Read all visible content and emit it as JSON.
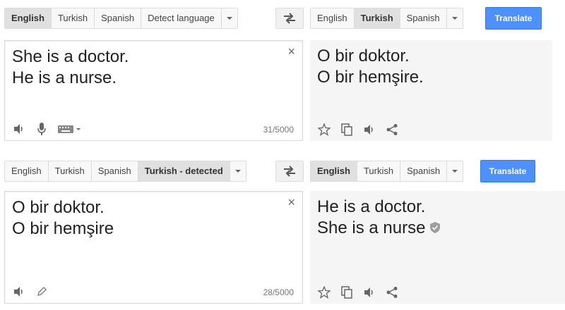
{
  "top": {
    "source_tabs": [
      "English",
      "Turkish",
      "Spanish",
      "Detect language"
    ],
    "source_active": "English",
    "target_tabs": [
      "English",
      "Turkish",
      "Spanish"
    ],
    "target_active": "Turkish",
    "translate_label": "Translate",
    "source_lines": [
      "She is a doctor.",
      "He is a nurse."
    ],
    "target_lines": [
      "O bir doktor.",
      "O bir hemşire."
    ],
    "char_count": "31/5000",
    "clear_symbol": "×"
  },
  "bottom": {
    "source_tabs": [
      "English",
      "Turkish",
      "Spanish",
      "Turkish - detected"
    ],
    "source_active": "Turkish - detected",
    "target_tabs": [
      "English",
      "Turkish",
      "Spanish"
    ],
    "target_active": "English",
    "translate_label": "Translate",
    "source_lines": [
      "O bir doktor.",
      "O bir hemşire"
    ],
    "target_lines": [
      "He is a doctor.",
      "She is a nurse"
    ],
    "char_count": "28/5000",
    "clear_symbol": "×"
  },
  "icons": {
    "listen": "speaker-icon",
    "mic": "microphone-icon",
    "keyboard": "keyboard-icon",
    "star": "star-icon",
    "copy": "copy-icon",
    "share": "share-icon",
    "edit": "pencil-icon",
    "swap": "swap-arrows-icon",
    "verified": "shield-check-icon"
  },
  "colors": {
    "accent": "#4d90fe",
    "active_tab": "#e0e0e0",
    "result_bg": "#f5f5f5"
  }
}
